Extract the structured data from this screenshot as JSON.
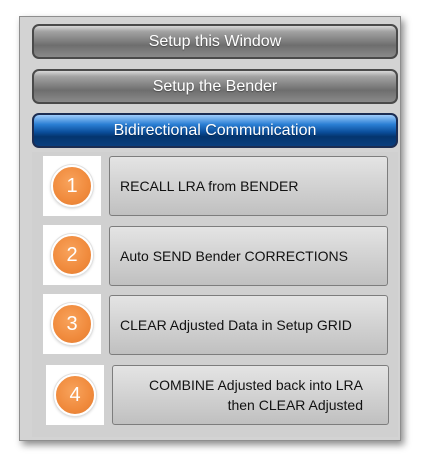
{
  "headers": {
    "setup_window": "Setup this Window",
    "setup_bender": "Setup the Bender",
    "bidirectional": "Bidirectional Communication"
  },
  "actions": [
    {
      "number": "1",
      "label": "RECALL LRA from BENDER"
    },
    {
      "number": "2",
      "label": "Auto SEND Bender CORRECTIONS"
    },
    {
      "number": "3",
      "label": "CLEAR Adjusted Data in Setup GRID"
    },
    {
      "number": "4",
      "label_line1": "COMBINE Adjusted back into LRA",
      "label_line2": "then CLEAR Adjusted"
    }
  ],
  "colors": {
    "active_header": "#0b4f9c",
    "number_badge": "#f08a3c",
    "panel_background": "#d3d3d3"
  }
}
